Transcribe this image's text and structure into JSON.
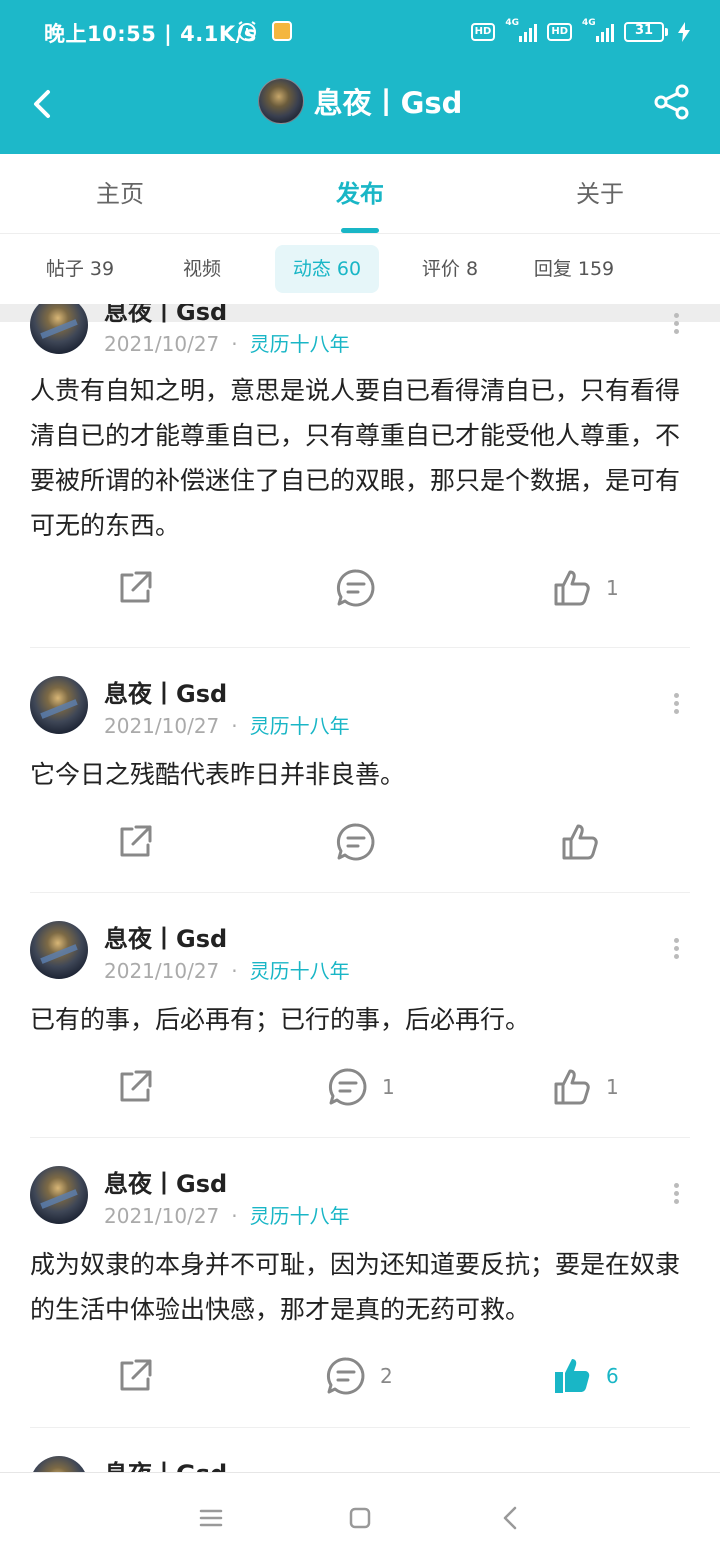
{
  "status": {
    "time": "晚上10:55 | 4.1K/s",
    "hd": "HD",
    "net": "4G",
    "battery": "31"
  },
  "header": {
    "title": "息夜丨Gsd"
  },
  "main_tabs": [
    {
      "label": "主页"
    },
    {
      "label": "发布"
    },
    {
      "label": "关于"
    }
  ],
  "sub_tabs": [
    {
      "label": "帖子 39"
    },
    {
      "label": "视频"
    },
    {
      "label": "动态 60"
    },
    {
      "label": "评价 8"
    },
    {
      "label": "回复 159"
    }
  ],
  "posts": [
    {
      "author": "息夜丨Gsd",
      "date": "2021/10/27",
      "dot": "·",
      "tag": "灵历十八年",
      "text": "人贵有自知之明，意思是说人要自已看得清自已，只有看得清自已的才能尊重自已，只有尊重自已才能受他人尊重，不要被所谓的补偿迷住了自已的双眼，那只是个数据，是可有可无的东西。",
      "comments": "",
      "likes": "1"
    },
    {
      "author": "息夜丨Gsd",
      "date": "2021/10/27",
      "dot": "·",
      "tag": "灵历十八年",
      "text": "它今日之残酷代表昨日并非良善。",
      "comments": "",
      "likes": ""
    },
    {
      "author": "息夜丨Gsd",
      "date": "2021/10/27",
      "dot": "·",
      "tag": "灵历十八年",
      "text": "已有的事，后必再有；已行的事，后必再行。",
      "comments": "1",
      "likes": "1"
    },
    {
      "author": "息夜丨Gsd",
      "date": "2021/10/27",
      "dot": "·",
      "tag": "灵历十八年",
      "text": "成为奴隶的本身并不可耻，因为还知道要反抗；要是在奴隶的生活中体验出快感，那才是真的无药可救。",
      "comments": "2",
      "likes": "6"
    },
    {
      "author": "息夜丨Gsd"
    }
  ],
  "colors": {
    "accent": "#1db8c9",
    "liked": "#19b6c6"
  },
  "icons": {
    "back": "back-arrow-icon",
    "share": "share-icon",
    "repost": "share-out-icon",
    "comment": "comment-icon",
    "like": "thumbs-up-icon",
    "more": "more-vertical-icon"
  }
}
